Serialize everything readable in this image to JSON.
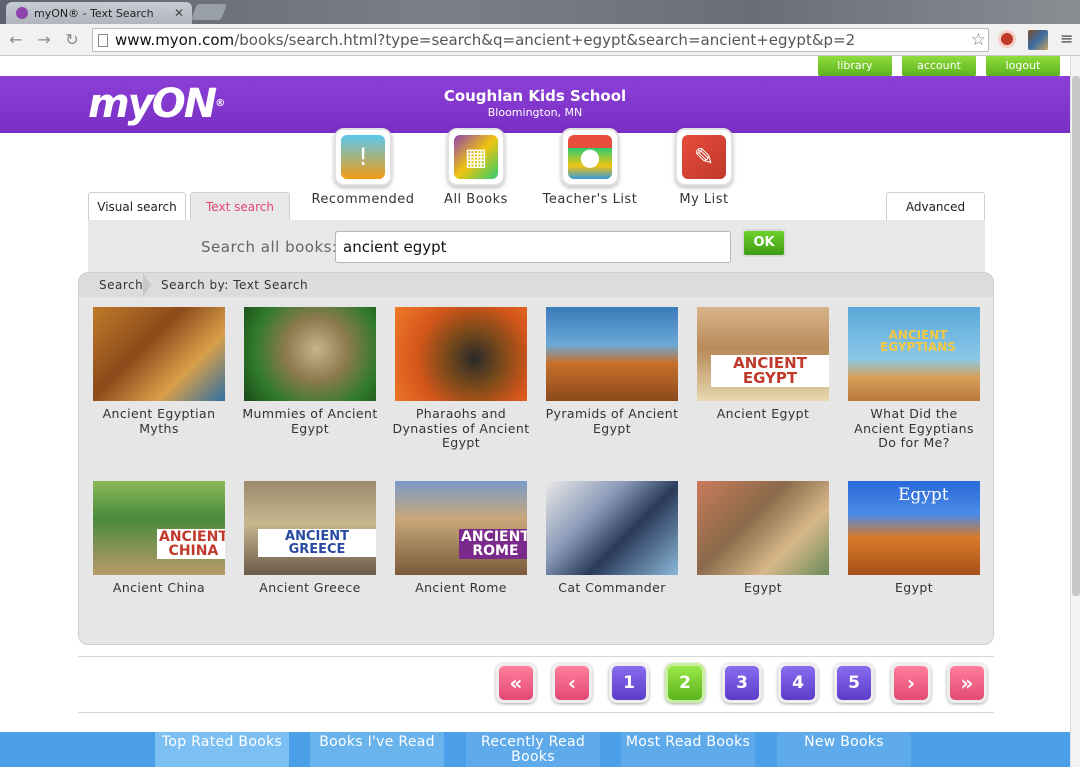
{
  "browser": {
    "tab_title": "myON® - Text Search",
    "url_host": "www.myon.com",
    "url_path": "/books/search.html?type=search&q=ancient+egypt&search=ancient+egypt&p=2"
  },
  "top_links": [
    "library",
    "account",
    "logout"
  ],
  "header": {
    "logo": "myON",
    "logo_mark": "®",
    "school_name": "Coughlan Kids School",
    "school_location": "Bloomington, MN"
  },
  "categories": [
    {
      "label": "Recommended",
      "icon": "lightbulb-book-icon"
    },
    {
      "label": "All Books",
      "icon": "all-books-icon"
    },
    {
      "label": "Teacher's List",
      "icon": "apple-books-icon"
    },
    {
      "label": "My List",
      "icon": "my-list-book-icon"
    }
  ],
  "search": {
    "tabs": [
      "Visual search",
      "Text search"
    ],
    "active_tab": "Text search",
    "advanced_label": "Advanced",
    "label": "Search all books:",
    "query": "ancient egypt",
    "ok_label": "OK"
  },
  "breadcrumb": {
    "root": "Search",
    "current": "Search by: Text Search"
  },
  "books": [
    {
      "title": "Ancient Egyptian Myths",
      "cover_text": ""
    },
    {
      "title": "Mummies of Ancient Egypt",
      "cover_text": ""
    },
    {
      "title": "Pharaohs and Dynasties of Ancient Egypt",
      "cover_text": ""
    },
    {
      "title": "Pyramids of Ancient Egypt",
      "cover_text": ""
    },
    {
      "title": "Ancient Egypt",
      "cover_text": "ANCIENT EGYPT"
    },
    {
      "title": "What Did the Ancient Egyptians Do for Me?",
      "cover_text": "ANCIENT EGYPTIANS"
    },
    {
      "title": "Ancient China",
      "cover_text": "ANCIENT CHINA"
    },
    {
      "title": "Ancient Greece",
      "cover_text": "ANCIENT GREECE"
    },
    {
      "title": "Ancient Rome",
      "cover_text": "ANCIENT ROME"
    },
    {
      "title": "Cat Commander",
      "cover_text": ""
    },
    {
      "title": "Egypt",
      "cover_text": ""
    },
    {
      "title": "Egypt",
      "cover_text": "Egypt"
    }
  ],
  "pagination": {
    "first": "«",
    "prev": "‹",
    "pages": [
      "1",
      "2",
      "3",
      "4",
      "5"
    ],
    "current": "2",
    "next": "›",
    "last": "»"
  },
  "bottom_tabs": [
    "Top Rated Books",
    "Books I've Read",
    "Recently Read Books",
    "Most Read Books",
    "New Books"
  ],
  "colors": {
    "header_purple": "#7a2fc4",
    "accent_green": "#5cb21e",
    "pager_pink": "#e24a72",
    "pager_purple": "#5b3cc9",
    "bottom_blue": "#4a9fe8",
    "active_tab_text": "#e0456f"
  }
}
